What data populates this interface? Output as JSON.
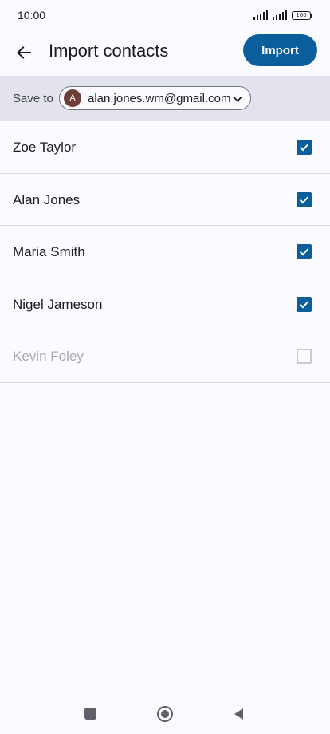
{
  "status_bar": {
    "time": "10:00",
    "battery": "100",
    "icons": [
      "signal-icon",
      "signal-icon",
      "battery-icon"
    ]
  },
  "header": {
    "back_icon": "arrow-left-icon",
    "title": "Import contacts",
    "import_label": "Import"
  },
  "save_to": {
    "label": "Save to",
    "avatar_letter": "A",
    "email": "alan.jones.wm@gmail.com",
    "dropdown_icon": "chevron-down-icon"
  },
  "contacts": [
    {
      "name": "Zoe Taylor",
      "checked": true,
      "enabled": true
    },
    {
      "name": "Alan Jones",
      "checked": true,
      "enabled": true
    },
    {
      "name": "Maria Smith",
      "checked": true,
      "enabled": true
    },
    {
      "name": "Nigel Jameson",
      "checked": true,
      "enabled": true
    },
    {
      "name": "Kevin Foley",
      "checked": false,
      "enabled": false
    }
  ],
  "nav_bar": {
    "icons": [
      "recents-square-icon",
      "home-circle-icon",
      "back-triangle-icon"
    ]
  },
  "colors": {
    "accent": "#0a5e9c",
    "background": "#fbfbff",
    "save_row_bg": "#e2e3ec",
    "avatar": "#6d3f36",
    "disabled_text": "#a9abb2"
  }
}
